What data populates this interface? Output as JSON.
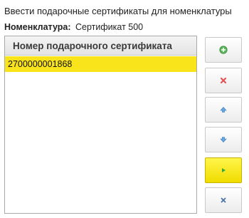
{
  "window": {
    "title": "Ввести подарочные сертификаты для номенклатуры"
  },
  "nomenclature": {
    "label": "Номенклатура:",
    "value": "Сертификат 500"
  },
  "table": {
    "header": "Номер подарочного сертификата",
    "rows": [
      "2700000001868"
    ]
  },
  "buttons": [
    {
      "name": "add",
      "icon": "plus-circle-icon",
      "color": "#4caf50"
    },
    {
      "name": "delete",
      "icon": "cross-icon",
      "color": "#e05555"
    },
    {
      "name": "move-up",
      "icon": "arrow-up-icon",
      "color": "#5b9bd5"
    },
    {
      "name": "move-down",
      "icon": "arrow-down-icon",
      "color": "#5b9bd5"
    },
    {
      "name": "confirm",
      "icon": "play-triangle-icon",
      "color": "#4caf50",
      "primary": true
    },
    {
      "name": "close",
      "icon": "close-x-icon",
      "color": "#4a74a8"
    }
  ],
  "colors": {
    "selected_row": "#f9e31a",
    "primary_button": "#f7e600"
  }
}
